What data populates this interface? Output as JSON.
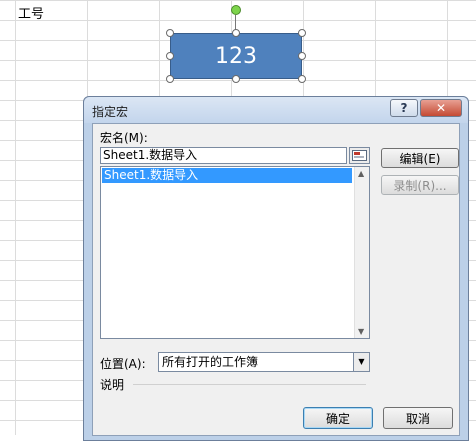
{
  "sheet": {
    "cell_label": "工号"
  },
  "shape": {
    "text": "123"
  },
  "dialog": {
    "title": "指定宏",
    "help_label": "?",
    "close_label": "✕",
    "macro_name_label": "宏名(M):",
    "macro_name_value": "Sheet1.数据导入",
    "macro_list": [
      "Sheet1.数据导入"
    ],
    "edit_button": "编辑(E)",
    "record_button": "录制(R)...",
    "location_label": "位置(A):",
    "location_value": "所有打开的工作簿",
    "description_label": "说明",
    "ok_button": "确定",
    "cancel_button": "取消"
  },
  "colors": {
    "shape_fill": "#4f81bd",
    "selection": "#3399ff",
    "dialog_frame": "#bcd0e8"
  }
}
